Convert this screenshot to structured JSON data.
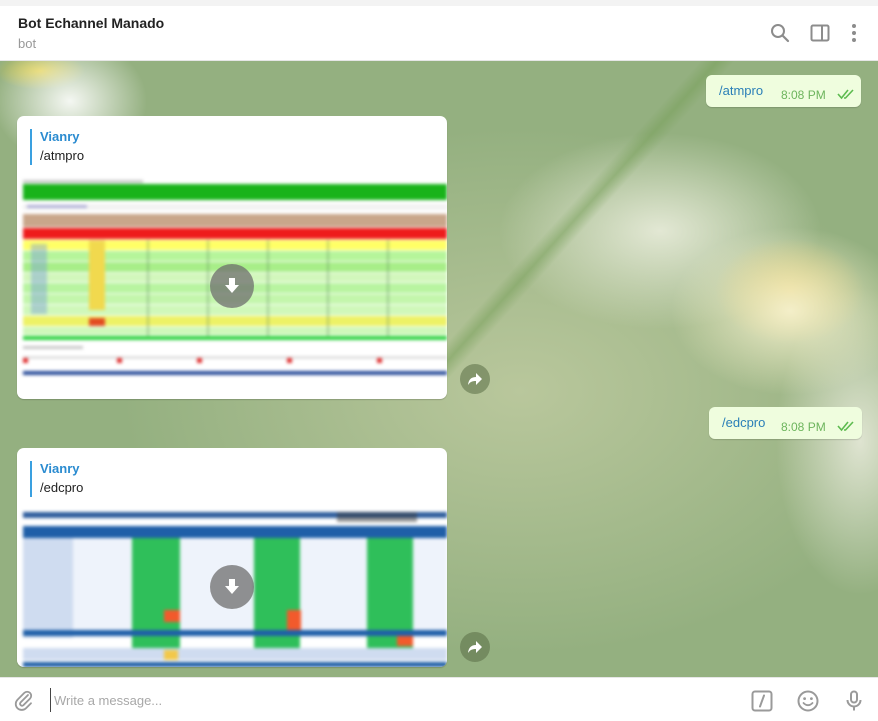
{
  "header": {
    "title": "Bot Echannel Manado",
    "subtitle": "bot"
  },
  "messages": {
    "out1": {
      "text": "/atmpro",
      "time": "8:08 PM"
    },
    "in1": {
      "quote_author": "Vianry",
      "quote_text": "/atmpro"
    },
    "out2": {
      "text": "/edcpro",
      "time": "8:08 PM"
    },
    "in2": {
      "quote_author": "Vianry",
      "quote_text": "/edcpro"
    }
  },
  "composer": {
    "placeholder": "Write a message..."
  },
  "colors": {
    "outgoing_bubble": "#effdde",
    "quote_author": "#2a8bd0",
    "time": "#6cb45c"
  }
}
